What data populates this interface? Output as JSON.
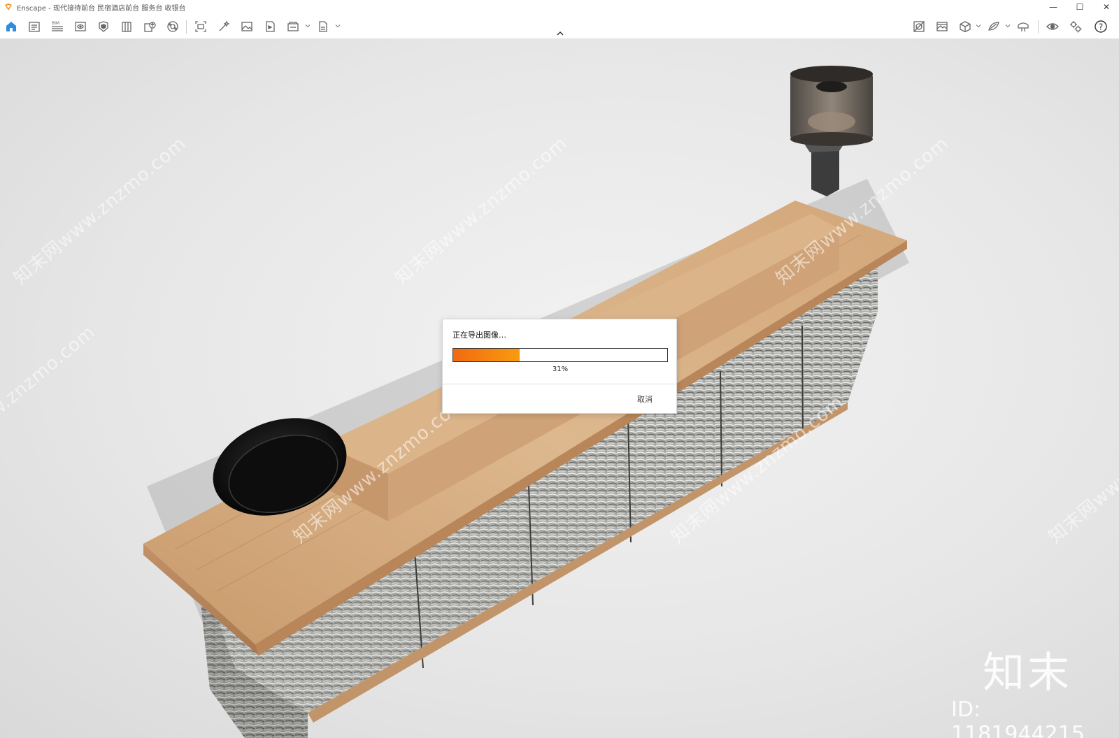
{
  "window": {
    "title": "Enscape - 现代接待前台 民宿酒店前台 服务台 收银台",
    "minimize": "—",
    "maximize": "☐",
    "close": "✕",
    "accent": "#f28c1e"
  },
  "toolbar": {
    "left_icons": [
      "home-icon",
      "notes-icon",
      "bim-icon",
      "views-icon",
      "asset-icon",
      "site-context-icon",
      "upload-icon",
      "panorama-icon",
      "capture-icon",
      "magic-wand-icon",
      "image-icon",
      "video-icon",
      "batch-render-icon",
      "export-file-icon"
    ],
    "bim_label": "BIM",
    "right_icons": [
      "material-editor-icon",
      "atmosphere-icon",
      "view-cube-icon",
      "sun-settings-icon",
      "vr-headset-icon",
      "visual-settings-icon",
      "settings-icon",
      "help-icon"
    ],
    "help_label": "?"
  },
  "dialog": {
    "message": "正在导出图像…",
    "progress": 0.31,
    "progress_text": "31%",
    "cancel_label": "取消",
    "progress_colors": [
      "#f26a10",
      "#f99b0f"
    ]
  },
  "watermarks": {
    "text": "知末网www.znzmo.com",
    "brand": "知末",
    "id_text": "ID: 1181944215"
  }
}
